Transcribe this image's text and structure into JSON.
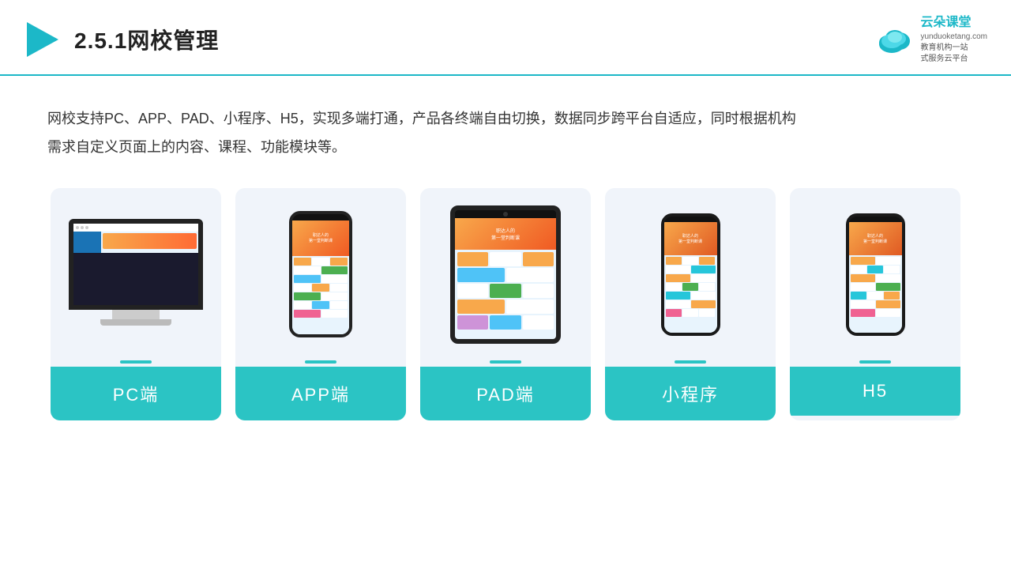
{
  "header": {
    "title": "2.5.1网校管理",
    "brand": {
      "name": "云朵课堂",
      "domain": "yunduoketang.com",
      "tagline": "教育机构一站\n式服务云平台"
    }
  },
  "description": "网校支持PC、APP、PAD、小程序、H5，实现多端打通，产品各终端自由切换，数据同步跨平台自适应，同时根据机构\n需求自定义页面上的内容、课程、功能模块等。",
  "cards": [
    {
      "id": "pc",
      "label": "PC端"
    },
    {
      "id": "app",
      "label": "APP端"
    },
    {
      "id": "pad",
      "label": "PAD端"
    },
    {
      "id": "miniapp",
      "label": "小程序"
    },
    {
      "id": "h5",
      "label": "H5"
    }
  ],
  "colors": {
    "teal": "#2bc4c4",
    "accent_blue": "#1cb8c8",
    "orange": "#f8a84b"
  }
}
